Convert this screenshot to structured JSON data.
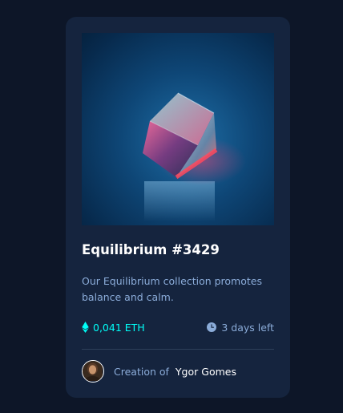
{
  "card": {
    "title": "Equilibrium #3429",
    "description": "Our Equilibrium collection promotes balance and calm.",
    "price": "0,041 ETH",
    "time_left": "3 days left",
    "creation_prefix": "Creation of",
    "creator_name": "Ygor Gomes"
  },
  "icons": {
    "price": "ethereum-icon",
    "time": "clock-icon",
    "art": "crystal-cube-image",
    "avatar": "creator-portrait"
  },
  "colors": {
    "background": "#0d1628",
    "card": "#15243e",
    "accent_cyan": "#00fff8",
    "soft_blue": "#8bacd9",
    "white": "#ffffff"
  }
}
